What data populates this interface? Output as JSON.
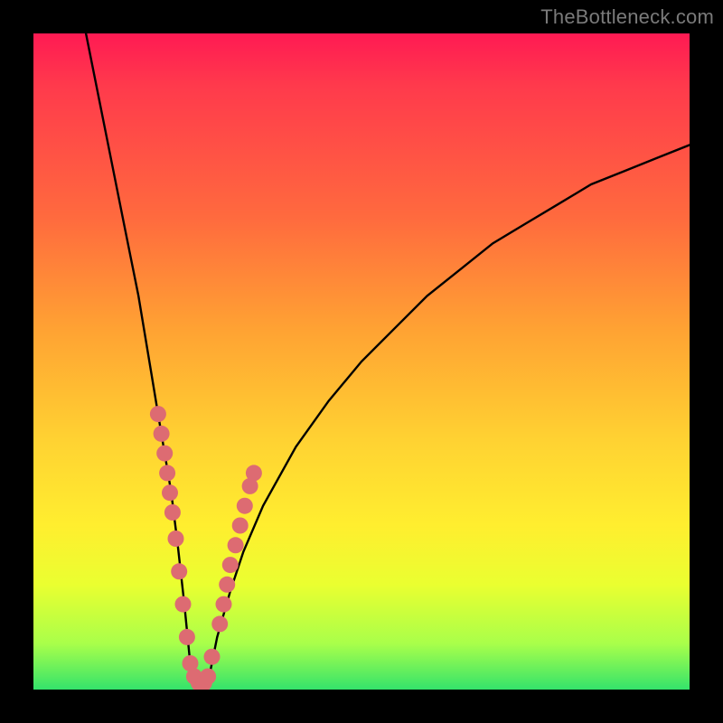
{
  "watermark": "TheBottleneck.com",
  "chart_data": {
    "type": "line",
    "title": "",
    "xlabel": "",
    "ylabel": "",
    "xlim": [
      0,
      100
    ],
    "ylim": [
      0,
      100
    ],
    "series": [
      {
        "name": "curve",
        "x": [
          8,
          10,
          12,
          14,
          16,
          18,
          19,
          20,
          21,
          22,
          23,
          24,
          25,
          26,
          27,
          28,
          30,
          32,
          35,
          40,
          45,
          50,
          55,
          60,
          65,
          70,
          75,
          80,
          85,
          90,
          95,
          100
        ],
        "y": [
          100,
          90,
          80,
          70,
          60,
          48,
          42,
          36,
          30,
          22,
          13,
          3,
          0,
          0,
          3,
          8,
          15,
          21,
          28,
          37,
          44,
          50,
          55,
          60,
          64,
          68,
          71,
          74,
          77,
          79,
          81,
          83
        ]
      }
    ],
    "markers": {
      "name": "dots",
      "color": "#dd6b72",
      "radius_px": 9,
      "x": [
        19.0,
        19.5,
        20.0,
        20.4,
        20.8,
        21.2,
        21.7,
        22.2,
        22.8,
        23.4,
        23.9,
        24.5,
        25.2,
        26.0,
        26.6,
        27.2,
        28.4,
        29.0,
        29.5,
        30.0,
        30.8,
        31.5,
        32.2,
        33.0,
        33.6
      ],
      "y": [
        42,
        39,
        36,
        33,
        30,
        27,
        23,
        18,
        13,
        8,
        4,
        2,
        1,
        1,
        2,
        5,
        10,
        13,
        16,
        19,
        22,
        25,
        28,
        31,
        33
      ]
    }
  }
}
